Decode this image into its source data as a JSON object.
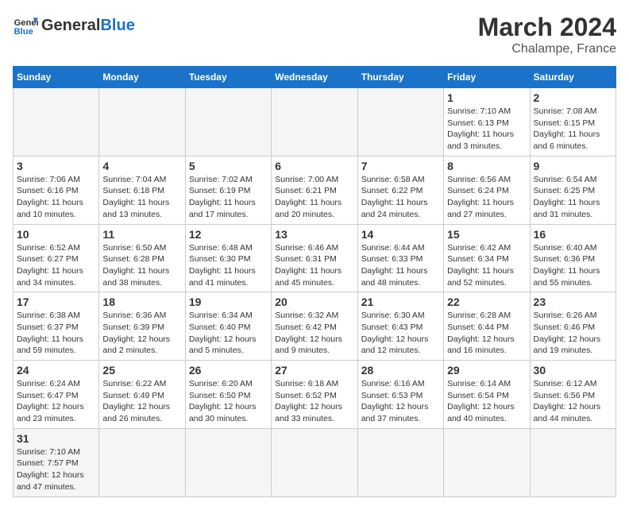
{
  "header": {
    "logo_general": "General",
    "logo_blue": "Blue",
    "month_title": "March 2024",
    "location": "Chalampe, France"
  },
  "weekdays": [
    "Sunday",
    "Monday",
    "Tuesday",
    "Wednesday",
    "Thursday",
    "Friday",
    "Saturday"
  ],
  "weeks": [
    [
      {
        "day": "",
        "info": ""
      },
      {
        "day": "",
        "info": ""
      },
      {
        "day": "",
        "info": ""
      },
      {
        "day": "",
        "info": ""
      },
      {
        "day": "",
        "info": ""
      },
      {
        "day": "1",
        "info": "Sunrise: 7:10 AM\nSunset: 6:13 PM\nDaylight: 11 hours\nand 3 minutes."
      },
      {
        "day": "2",
        "info": "Sunrise: 7:08 AM\nSunset: 6:15 PM\nDaylight: 11 hours\nand 6 minutes."
      }
    ],
    [
      {
        "day": "3",
        "info": "Sunrise: 7:06 AM\nSunset: 6:16 PM\nDaylight: 11 hours\nand 10 minutes."
      },
      {
        "day": "4",
        "info": "Sunrise: 7:04 AM\nSunset: 6:18 PM\nDaylight: 11 hours\nand 13 minutes."
      },
      {
        "day": "5",
        "info": "Sunrise: 7:02 AM\nSunset: 6:19 PM\nDaylight: 11 hours\nand 17 minutes."
      },
      {
        "day": "6",
        "info": "Sunrise: 7:00 AM\nSunset: 6:21 PM\nDaylight: 11 hours\nand 20 minutes."
      },
      {
        "day": "7",
        "info": "Sunrise: 6:58 AM\nSunset: 6:22 PM\nDaylight: 11 hours\nand 24 minutes."
      },
      {
        "day": "8",
        "info": "Sunrise: 6:56 AM\nSunset: 6:24 PM\nDaylight: 11 hours\nand 27 minutes."
      },
      {
        "day": "9",
        "info": "Sunrise: 6:54 AM\nSunset: 6:25 PM\nDaylight: 11 hours\nand 31 minutes."
      }
    ],
    [
      {
        "day": "10",
        "info": "Sunrise: 6:52 AM\nSunset: 6:27 PM\nDaylight: 11 hours\nand 34 minutes."
      },
      {
        "day": "11",
        "info": "Sunrise: 6:50 AM\nSunset: 6:28 PM\nDaylight: 11 hours\nand 38 minutes."
      },
      {
        "day": "12",
        "info": "Sunrise: 6:48 AM\nSunset: 6:30 PM\nDaylight: 11 hours\nand 41 minutes."
      },
      {
        "day": "13",
        "info": "Sunrise: 6:46 AM\nSunset: 6:31 PM\nDaylight: 11 hours\nand 45 minutes."
      },
      {
        "day": "14",
        "info": "Sunrise: 6:44 AM\nSunset: 6:33 PM\nDaylight: 11 hours\nand 48 minutes."
      },
      {
        "day": "15",
        "info": "Sunrise: 6:42 AM\nSunset: 6:34 PM\nDaylight: 11 hours\nand 52 minutes."
      },
      {
        "day": "16",
        "info": "Sunrise: 6:40 AM\nSunset: 6:36 PM\nDaylight: 11 hours\nand 55 minutes."
      }
    ],
    [
      {
        "day": "17",
        "info": "Sunrise: 6:38 AM\nSunset: 6:37 PM\nDaylight: 11 hours\nand 59 minutes."
      },
      {
        "day": "18",
        "info": "Sunrise: 6:36 AM\nSunset: 6:39 PM\nDaylight: 12 hours\nand 2 minutes."
      },
      {
        "day": "19",
        "info": "Sunrise: 6:34 AM\nSunset: 6:40 PM\nDaylight: 12 hours\nand 5 minutes."
      },
      {
        "day": "20",
        "info": "Sunrise: 6:32 AM\nSunset: 6:42 PM\nDaylight: 12 hours\nand 9 minutes."
      },
      {
        "day": "21",
        "info": "Sunrise: 6:30 AM\nSunset: 6:43 PM\nDaylight: 12 hours\nand 12 minutes."
      },
      {
        "day": "22",
        "info": "Sunrise: 6:28 AM\nSunset: 6:44 PM\nDaylight: 12 hours\nand 16 minutes."
      },
      {
        "day": "23",
        "info": "Sunrise: 6:26 AM\nSunset: 6:46 PM\nDaylight: 12 hours\nand 19 minutes."
      }
    ],
    [
      {
        "day": "24",
        "info": "Sunrise: 6:24 AM\nSunset: 6:47 PM\nDaylight: 12 hours\nand 23 minutes."
      },
      {
        "day": "25",
        "info": "Sunrise: 6:22 AM\nSunset: 6:49 PM\nDaylight: 12 hours\nand 26 minutes."
      },
      {
        "day": "26",
        "info": "Sunrise: 6:20 AM\nSunset: 6:50 PM\nDaylight: 12 hours\nand 30 minutes."
      },
      {
        "day": "27",
        "info": "Sunrise: 6:18 AM\nSunset: 6:52 PM\nDaylight: 12 hours\nand 33 minutes."
      },
      {
        "day": "28",
        "info": "Sunrise: 6:16 AM\nSunset: 6:53 PM\nDaylight: 12 hours\nand 37 minutes."
      },
      {
        "day": "29",
        "info": "Sunrise: 6:14 AM\nSunset: 6:54 PM\nDaylight: 12 hours\nand 40 minutes."
      },
      {
        "day": "30",
        "info": "Sunrise: 6:12 AM\nSunset: 6:56 PM\nDaylight: 12 hours\nand 44 minutes."
      }
    ],
    [
      {
        "day": "31",
        "info": "Sunrise: 7:10 AM\nSunset: 7:57 PM\nDaylight: 12 hours\nand 47 minutes."
      },
      {
        "day": "",
        "info": ""
      },
      {
        "day": "",
        "info": ""
      },
      {
        "day": "",
        "info": ""
      },
      {
        "day": "",
        "info": ""
      },
      {
        "day": "",
        "info": ""
      },
      {
        "day": "",
        "info": ""
      }
    ]
  ]
}
